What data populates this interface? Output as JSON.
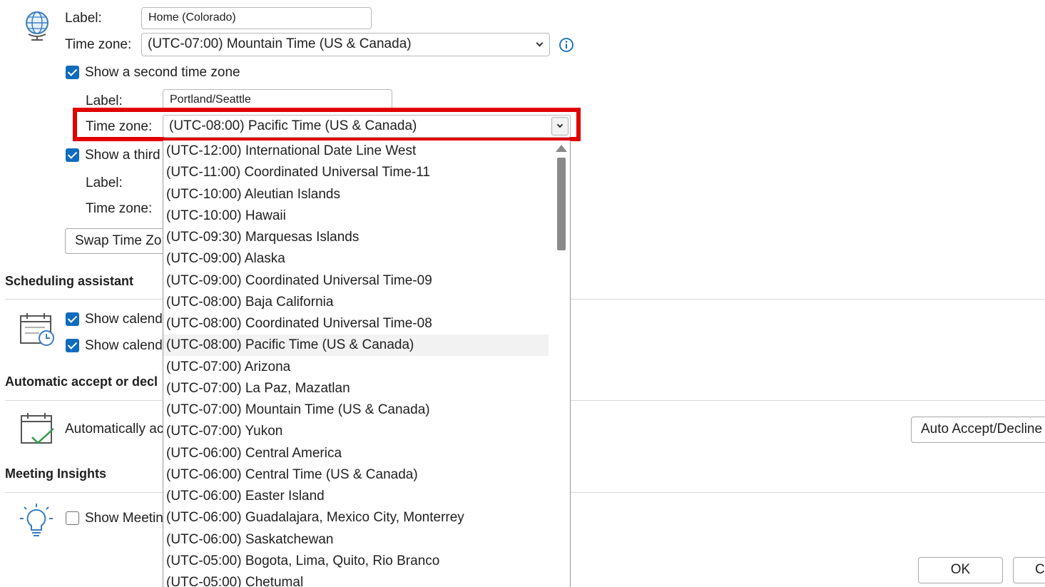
{
  "time_zones": {
    "primary": {
      "label_caption": "Label:",
      "label_value": "Home (Colorado)",
      "tz_caption": "Time zone:",
      "tz_value": "(UTC-07:00) Mountain Time (US & Canada)"
    },
    "second": {
      "checkbox_label": "Show a second time zone",
      "checked": true,
      "label_caption": "Label:",
      "label_value": "Portland/Seattle",
      "tz_caption": "Time zone:",
      "tz_value": "(UTC-08:00) Pacific Time (US & Canada)"
    },
    "third": {
      "checkbox_label": "Show a third",
      "checked": true,
      "label_caption": "Label:",
      "tz_caption": "Time zone:"
    },
    "swap_button": "Swap Time Zo"
  },
  "scheduling_assistant": {
    "title": "Scheduling assistant",
    "option1": "Show calend",
    "option2": "Show calend"
  },
  "auto_accept": {
    "title": "Automatic accept or decl",
    "text": "Automatically ac",
    "button": "Auto Accept/Decline"
  },
  "meeting_insights": {
    "title": "Meeting Insights",
    "option": "Show Meetin",
    "checked": false
  },
  "buttons": {
    "ok": "OK",
    "cancel": "C"
  },
  "dropdown": {
    "selected_index": 9,
    "items": [
      "(UTC-12:00) International Date Line West",
      "(UTC-11:00) Coordinated Universal Time-11",
      "(UTC-10:00) Aleutian Islands",
      "(UTC-10:00) Hawaii",
      "(UTC-09:30) Marquesas Islands",
      "(UTC-09:00) Alaska",
      "(UTC-09:00) Coordinated Universal Time-09",
      "(UTC-08:00) Baja California",
      "(UTC-08:00) Coordinated Universal Time-08",
      "(UTC-08:00) Pacific Time (US & Canada)",
      "(UTC-07:00) Arizona",
      "(UTC-07:00) La Paz, Mazatlan",
      "(UTC-07:00) Mountain Time (US & Canada)",
      "(UTC-07:00) Yukon",
      "(UTC-06:00) Central America",
      "(UTC-06:00) Central Time (US & Canada)",
      "(UTC-06:00) Easter Island",
      "(UTC-06:00) Guadalajara, Mexico City, Monterrey",
      "(UTC-06:00) Saskatchewan",
      "(UTC-05:00) Bogota, Lima, Quito, Rio Branco",
      "(UTC-05:00) Chetumal"
    ]
  },
  "colors": {
    "accent": "#0f6cbd",
    "highlight_box": "#e00000"
  },
  "icons": [
    "globe-icon",
    "info-icon",
    "calendar-clock-icon",
    "calendar-check-icon",
    "lightbulb-icon"
  ]
}
